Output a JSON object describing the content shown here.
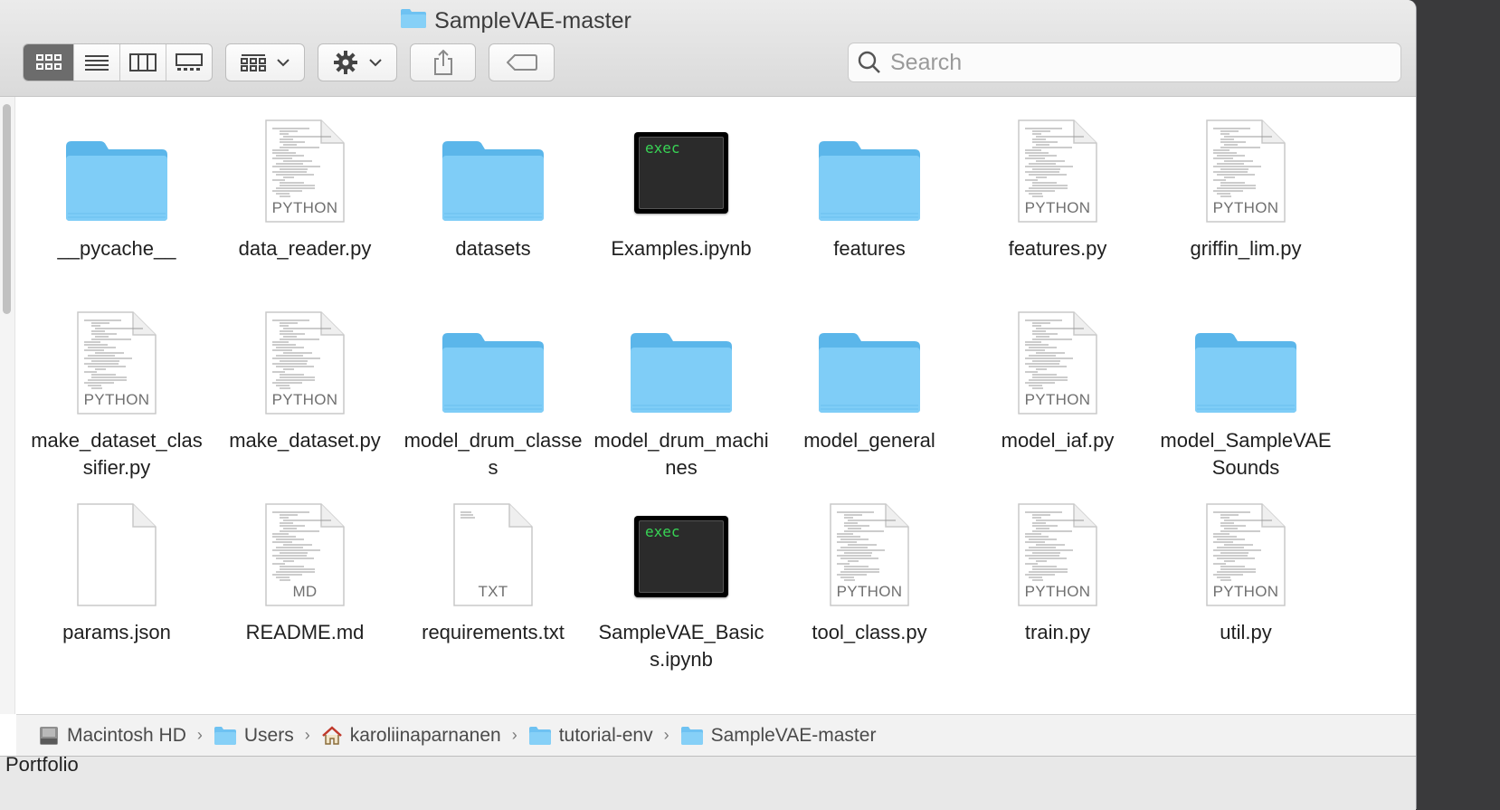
{
  "window": {
    "title": "SampleVAE-master"
  },
  "toolbar": {
    "view_modes": [
      "icon-view",
      "list-view",
      "column-view",
      "gallery-view"
    ],
    "active_view": "icon-view",
    "group_icon": "group-by-icon",
    "action_icon": "gear-icon",
    "share_icon": "share-icon",
    "tag_icon": "tag-icon"
  },
  "search": {
    "placeholder": "Search",
    "value": ""
  },
  "files": [
    {
      "name": "__pycache__",
      "kind": "folder"
    },
    {
      "name": "data_reader.py",
      "kind": "doc",
      "tag": "PYTHON"
    },
    {
      "name": "datasets",
      "kind": "folder"
    },
    {
      "name": "Examples.ipynb",
      "kind": "exec",
      "tag": "exec"
    },
    {
      "name": "features",
      "kind": "folder"
    },
    {
      "name": "features.py",
      "kind": "doc",
      "tag": "PYTHON"
    },
    {
      "name": "griffin_lim.py",
      "kind": "doc",
      "tag": "PYTHON"
    },
    {
      "name": "make_dataset_classifier.py",
      "kind": "doc",
      "tag": "PYTHON"
    },
    {
      "name": "make_dataset.py",
      "kind": "doc",
      "tag": "PYTHON"
    },
    {
      "name": "model_drum_classes",
      "kind": "folder"
    },
    {
      "name": "model_drum_machines",
      "kind": "folder"
    },
    {
      "name": "model_general",
      "kind": "folder"
    },
    {
      "name": "model_iaf.py",
      "kind": "doc",
      "tag": "PYTHON"
    },
    {
      "name": "model_SampleVAESounds",
      "kind": "folder"
    },
    {
      "name": "params.json",
      "kind": "blank"
    },
    {
      "name": "README.md",
      "kind": "doc",
      "tag": "MD"
    },
    {
      "name": "requirements.txt",
      "kind": "doc-light",
      "tag": "TXT"
    },
    {
      "name": "SampleVAE_Basics.ipynb",
      "kind": "exec",
      "tag": "exec"
    },
    {
      "name": "tool_class.py",
      "kind": "doc",
      "tag": "PYTHON"
    },
    {
      "name": "train.py",
      "kind": "doc",
      "tag": "PYTHON"
    },
    {
      "name": "util.py",
      "kind": "doc",
      "tag": "PYTHON"
    }
  ],
  "path": [
    {
      "label": "Macintosh HD",
      "icon": "hard-drive-icon"
    },
    {
      "label": "Users",
      "icon": "users-folder-icon"
    },
    {
      "label": "karoliinaparnanen",
      "icon": "home-icon"
    },
    {
      "label": "tutorial-env",
      "icon": "folder-icon"
    },
    {
      "label": "SampleVAE-master",
      "icon": "folder-icon"
    }
  ],
  "path_separator": "›",
  "background_window": {
    "label": "Portfolio"
  },
  "colors": {
    "folder": "#7fcdf7",
    "folder_dark": "#5bb6ea",
    "exec_text": "#38d455",
    "selected_segment": "#6c6c6c"
  }
}
